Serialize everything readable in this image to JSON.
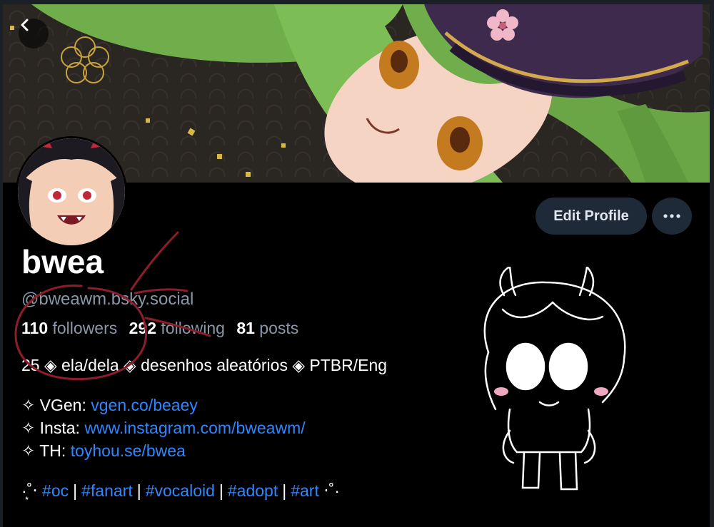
{
  "profile": {
    "display_name": "bwea",
    "handle": "@bweawm.bsky.social",
    "followers_count": "110",
    "followers_label": "followers",
    "following_count": "292",
    "following_label": "following",
    "posts_count": "81",
    "posts_label": "posts"
  },
  "actions": {
    "edit_profile_label": "Edit Profile",
    "more_label": "···"
  },
  "bio": {
    "intro": "25 ◈ ela/dela ◈ desenhos aleatórios ◈ PTBR/Eng",
    "links": [
      {
        "prefix": "✧ VGen: ",
        "text": "vgen.co/beaey"
      },
      {
        "prefix": "✧ Insta: ",
        "text": "www.instagram.com/bweawm/"
      },
      {
        "prefix": "✧ TH: ",
        "text": "toyhou.se/bwea"
      }
    ],
    "tags_prefix": "·͙˚‧",
    "tags": [
      "#oc",
      "#fanart",
      "#vocaloid",
      "#adopt",
      "#art"
    ],
    "tags_suffix": "‧˚·"
  },
  "icons": {
    "back": "chevron-left-icon",
    "more": "ellipsis-icon"
  },
  "colors": {
    "background": "#000000",
    "link": "#2f86ff",
    "muted": "#8a97a8",
    "button_bg": "#1e2a37",
    "annotation": "#8e1c2c",
    "banner_hair": "#6fae4a",
    "banner_hat": "#3d2a4d"
  }
}
